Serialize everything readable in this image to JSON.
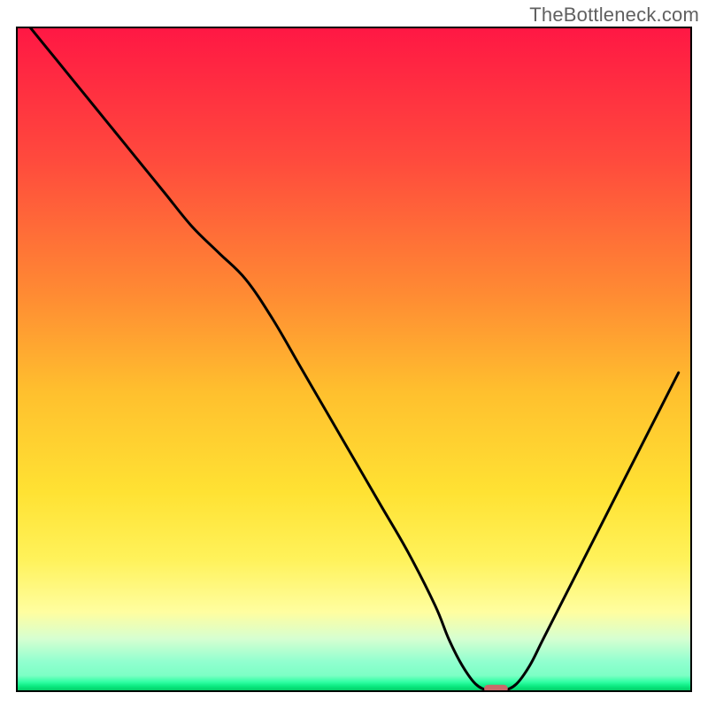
{
  "watermark": "TheBottleneck.com",
  "chart_data": {
    "type": "line",
    "title": "",
    "xlabel": "",
    "ylabel": "",
    "xlim": [
      0,
      100
    ],
    "ylim": [
      0,
      100
    ],
    "grid": false,
    "legend": false,
    "series": [
      {
        "name": "curve",
        "x": [
          2,
          6,
          10,
          14,
          18,
          22,
          26,
          30,
          34,
          38,
          42,
          46,
          50,
          54,
          58,
          62,
          64,
          66,
          68,
          70,
          72,
          74,
          76,
          78,
          82,
          86,
          90,
          94,
          98
        ],
        "y": [
          100,
          95,
          90,
          85,
          80,
          75,
          70,
          66,
          62,
          56,
          49,
          42,
          35,
          28,
          21,
          13,
          8,
          4,
          1.2,
          0.2,
          0.2,
          1.2,
          4,
          8,
          16,
          24,
          32,
          40,
          48
        ],
        "color": "#000000",
        "stroke_width": 3
      }
    ],
    "marker": {
      "x": 71,
      "y": 0.5,
      "color": "#c96a6a",
      "shape": "rounded-rect",
      "width_frac": 0.035,
      "height_frac": 0.012
    },
    "background_gradient": {
      "type": "vertical",
      "stops": [
        {
          "pos": 0.0,
          "color": "#ff1744"
        },
        {
          "pos": 0.2,
          "color": "#ff4a3d"
        },
        {
          "pos": 0.4,
          "color": "#ff8a33"
        },
        {
          "pos": 0.55,
          "color": "#ffc02e"
        },
        {
          "pos": 0.7,
          "color": "#ffe233"
        },
        {
          "pos": 0.8,
          "color": "#fff25a"
        },
        {
          "pos": 0.88,
          "color": "#fffea0"
        },
        {
          "pos": 0.92,
          "color": "#d6ffd1"
        },
        {
          "pos": 0.955,
          "color": "#90ffcf"
        },
        {
          "pos": 0.975,
          "color": "#7dffc5"
        },
        {
          "pos": 0.985,
          "color": "#2fffa3"
        },
        {
          "pos": 0.992,
          "color": "#08e77d"
        },
        {
          "pos": 1.0,
          "color": "#03c05f"
        }
      ]
    },
    "frame": {
      "color": "#000000",
      "width": 4
    }
  }
}
